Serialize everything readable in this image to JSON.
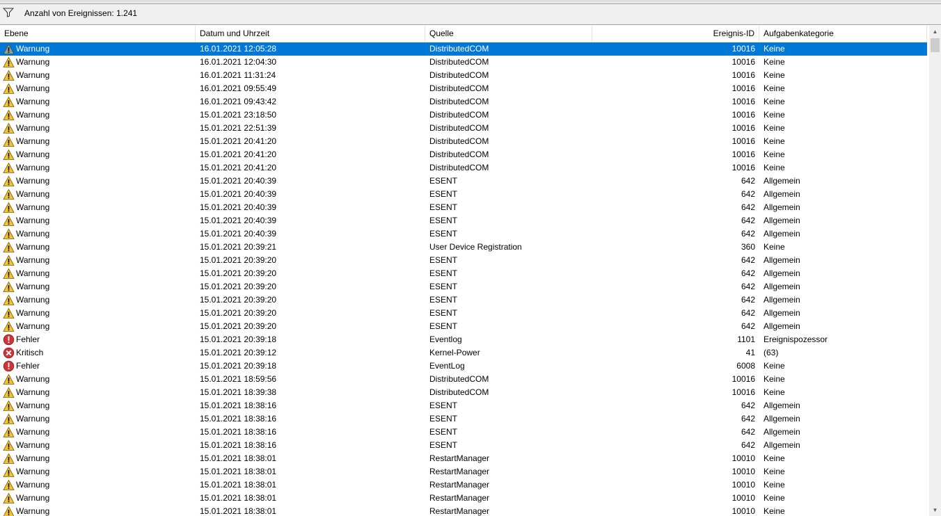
{
  "filter": {
    "icon": "filter-icon",
    "count_text": "Anzahl von Ereignissen: 1.241"
  },
  "columns": {
    "level": "Ebene",
    "datetime": "Datum und Uhrzeit",
    "source": "Quelle",
    "event_id": "Ereignis-ID",
    "category": "Aufgabenkategorie"
  },
  "colors": {
    "selection": "#0078d7",
    "warning": "#f4c430",
    "error": "#d13438"
  },
  "rows": [
    {
      "icon": "warning",
      "level": "Warnung",
      "datetime": "16.01.2021 12:05:28",
      "source": "DistributedCOM",
      "event_id": "10016",
      "category": "Keine",
      "selected": true
    },
    {
      "icon": "warning",
      "level": "Warnung",
      "datetime": "16.01.2021 12:04:30",
      "source": "DistributedCOM",
      "event_id": "10016",
      "category": "Keine"
    },
    {
      "icon": "warning",
      "level": "Warnung",
      "datetime": "16.01.2021 11:31:24",
      "source": "DistributedCOM",
      "event_id": "10016",
      "category": "Keine"
    },
    {
      "icon": "warning",
      "level": "Warnung",
      "datetime": "16.01.2021 09:55:49",
      "source": "DistributedCOM",
      "event_id": "10016",
      "category": "Keine"
    },
    {
      "icon": "warning",
      "level": "Warnung",
      "datetime": "16.01.2021 09:43:42",
      "source": "DistributedCOM",
      "event_id": "10016",
      "category": "Keine"
    },
    {
      "icon": "warning",
      "level": "Warnung",
      "datetime": "15.01.2021 23:18:50",
      "source": "DistributedCOM",
      "event_id": "10016",
      "category": "Keine"
    },
    {
      "icon": "warning",
      "level": "Warnung",
      "datetime": "15.01.2021 22:51:39",
      "source": "DistributedCOM",
      "event_id": "10016",
      "category": "Keine"
    },
    {
      "icon": "warning",
      "level": "Warnung",
      "datetime": "15.01.2021 20:41:20",
      "source": "DistributedCOM",
      "event_id": "10016",
      "category": "Keine"
    },
    {
      "icon": "warning",
      "level": "Warnung",
      "datetime": "15.01.2021 20:41:20",
      "source": "DistributedCOM",
      "event_id": "10016",
      "category": "Keine"
    },
    {
      "icon": "warning",
      "level": "Warnung",
      "datetime": "15.01.2021 20:41:20",
      "source": "DistributedCOM",
      "event_id": "10016",
      "category": "Keine"
    },
    {
      "icon": "warning",
      "level": "Warnung",
      "datetime": "15.01.2021 20:40:39",
      "source": "ESENT",
      "event_id": "642",
      "category": "Allgemein"
    },
    {
      "icon": "warning",
      "level": "Warnung",
      "datetime": "15.01.2021 20:40:39",
      "source": "ESENT",
      "event_id": "642",
      "category": "Allgemein"
    },
    {
      "icon": "warning",
      "level": "Warnung",
      "datetime": "15.01.2021 20:40:39",
      "source": "ESENT",
      "event_id": "642",
      "category": "Allgemein"
    },
    {
      "icon": "warning",
      "level": "Warnung",
      "datetime": "15.01.2021 20:40:39",
      "source": "ESENT",
      "event_id": "642",
      "category": "Allgemein"
    },
    {
      "icon": "warning",
      "level": "Warnung",
      "datetime": "15.01.2021 20:40:39",
      "source": "ESENT",
      "event_id": "642",
      "category": "Allgemein"
    },
    {
      "icon": "warning",
      "level": "Warnung",
      "datetime": "15.01.2021 20:39:21",
      "source": "User Device Registration",
      "event_id": "360",
      "category": "Keine"
    },
    {
      "icon": "warning",
      "level": "Warnung",
      "datetime": "15.01.2021 20:39:20",
      "source": "ESENT",
      "event_id": "642",
      "category": "Allgemein"
    },
    {
      "icon": "warning",
      "level": "Warnung",
      "datetime": "15.01.2021 20:39:20",
      "source": "ESENT",
      "event_id": "642",
      "category": "Allgemein"
    },
    {
      "icon": "warning",
      "level": "Warnung",
      "datetime": "15.01.2021 20:39:20",
      "source": "ESENT",
      "event_id": "642",
      "category": "Allgemein"
    },
    {
      "icon": "warning",
      "level": "Warnung",
      "datetime": "15.01.2021 20:39:20",
      "source": "ESENT",
      "event_id": "642",
      "category": "Allgemein"
    },
    {
      "icon": "warning",
      "level": "Warnung",
      "datetime": "15.01.2021 20:39:20",
      "source": "ESENT",
      "event_id": "642",
      "category": "Allgemein"
    },
    {
      "icon": "warning",
      "level": "Warnung",
      "datetime": "15.01.2021 20:39:20",
      "source": "ESENT",
      "event_id": "642",
      "category": "Allgemein"
    },
    {
      "icon": "error",
      "level": "Fehler",
      "datetime": "15.01.2021 20:39:18",
      "source": "Eventlog",
      "event_id": "1101",
      "category": "Ereignispozessor"
    },
    {
      "icon": "critical",
      "level": "Kritisch",
      "datetime": "15.01.2021 20:39:12",
      "source": "Kernel-Power",
      "event_id": "41",
      "category": "(63)"
    },
    {
      "icon": "error",
      "level": "Fehler",
      "datetime": "15.01.2021 20:39:18",
      "source": "EventLog",
      "event_id": "6008",
      "category": "Keine"
    },
    {
      "icon": "warning",
      "level": "Warnung",
      "datetime": "15.01.2021 18:59:56",
      "source": "DistributedCOM",
      "event_id": "10016",
      "category": "Keine"
    },
    {
      "icon": "warning",
      "level": "Warnung",
      "datetime": "15.01.2021 18:39:38",
      "source": "DistributedCOM",
      "event_id": "10016",
      "category": "Keine"
    },
    {
      "icon": "warning",
      "level": "Warnung",
      "datetime": "15.01.2021 18:38:16",
      "source": "ESENT",
      "event_id": "642",
      "category": "Allgemein"
    },
    {
      "icon": "warning",
      "level": "Warnung",
      "datetime": "15.01.2021 18:38:16",
      "source": "ESENT",
      "event_id": "642",
      "category": "Allgemein"
    },
    {
      "icon": "warning",
      "level": "Warnung",
      "datetime": "15.01.2021 18:38:16",
      "source": "ESENT",
      "event_id": "642",
      "category": "Allgemein"
    },
    {
      "icon": "warning",
      "level": "Warnung",
      "datetime": "15.01.2021 18:38:16",
      "source": "ESENT",
      "event_id": "642",
      "category": "Allgemein"
    },
    {
      "icon": "warning",
      "level": "Warnung",
      "datetime": "15.01.2021 18:38:01",
      "source": "RestartManager",
      "event_id": "10010",
      "category": "Keine"
    },
    {
      "icon": "warning",
      "level": "Warnung",
      "datetime": "15.01.2021 18:38:01",
      "source": "RestartManager",
      "event_id": "10010",
      "category": "Keine"
    },
    {
      "icon": "warning",
      "level": "Warnung",
      "datetime": "15.01.2021 18:38:01",
      "source": "RestartManager",
      "event_id": "10010",
      "category": "Keine"
    },
    {
      "icon": "warning",
      "level": "Warnung",
      "datetime": "15.01.2021 18:38:01",
      "source": "RestartManager",
      "event_id": "10010",
      "category": "Keine"
    },
    {
      "icon": "warning",
      "level": "Warnung",
      "datetime": "15.01.2021 18:38:01",
      "source": "RestartManager",
      "event_id": "10010",
      "category": "Keine"
    }
  ]
}
